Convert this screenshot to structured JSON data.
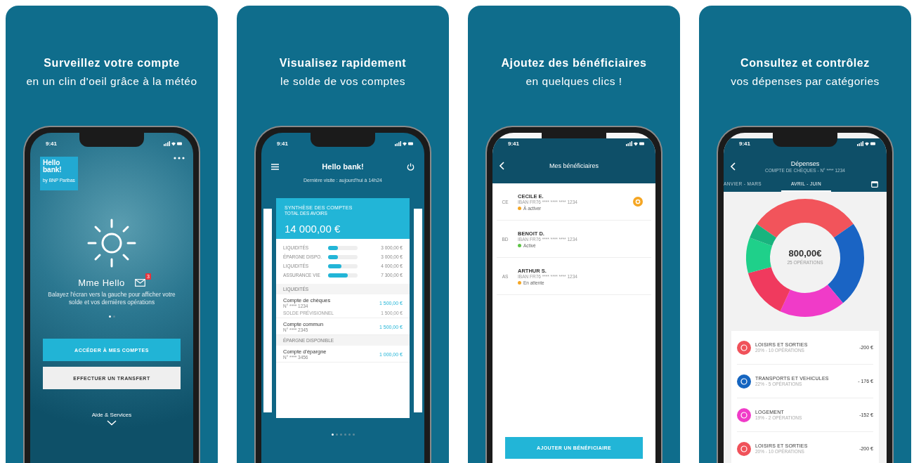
{
  "panels": [
    {
      "kind": "weather",
      "title": "Surveillez votre compte",
      "subtitle": "en un clin d'oeil grâce à la météo",
      "phone": {
        "time": "9:41",
        "logo": {
          "line_1": "Hello",
          "line_2": "bank!",
          "tagline": "by BNP Paribas"
        },
        "greeting": "Mme Hello",
        "message_badge": "3",
        "hint": "Balayez l'écran vers la gauche pour afficher votre solde et vos dernières opérations",
        "pages": [
          {
            "selected": true
          },
          {
            "selected": false
          }
        ],
        "buttons": [
          {
            "label": "ACCÉDER À MES COMPTES",
            "kind": "primary"
          },
          {
            "label": "EFFECTUER UN TRANSFERT",
            "kind": "secondary"
          }
        ],
        "help": "Aide & Services"
      }
    },
    {
      "kind": "accounts",
      "title": "Visualisez rapidement",
      "subtitle": "le solde de vos comptes",
      "phone": {
        "time": "9:41",
        "app_title": "Hello bank!",
        "last_visit": "Dernière visite : aujourd'hui à 14h24",
        "summary": {
          "title": "SYNTHÈSE DES COMPTES",
          "subtitle": "TOTAL DES AVOIRS",
          "total": "14 000,00 €",
          "bars": [
            {
              "label": "LIQUIDITÉS",
              "level": 0.33,
              "amount": "3 000,00 €"
            },
            {
              "label": "ÉPARGNE DISPO.",
              "level": 0.33,
              "amount": "3 000,00 €"
            },
            {
              "label": "LIQUIDITÉS",
              "level": 0.45,
              "amount": "4 000,00 €"
            },
            {
              "label": "ASSURANCE VIE",
              "level": 0.67,
              "amount": "7 300,00 €"
            }
          ]
        },
        "groups": [
          {
            "heading": "LIQUIDITÉS",
            "accounts": [
              {
                "name": "Compte de chèques",
                "number": "N° **** 1234",
                "balance": "1 500,00 €",
                "forecast_label": "SOLDE PRÉVISIONNEL",
                "forecast_amount": "1 500,00 €"
              },
              {
                "name": "Compte commun",
                "number": "N° **** 2345",
                "balance": "1 500,00 €"
              }
            ]
          },
          {
            "heading": "ÉPARGNE DISPONIBLE",
            "accounts": [
              {
                "name": "Compte d'épargne",
                "number": "N° **** 3456",
                "balance": "1 000,00 €"
              }
            ]
          }
        ],
        "pages": [
          {
            "selected": true
          },
          {
            "selected": false
          },
          {
            "selected": false
          },
          {
            "selected": false
          },
          {
            "selected": false
          },
          {
            "selected": false
          }
        ]
      }
    },
    {
      "kind": "beneficiaries",
      "title": "Ajoutez des bénéficiaires",
      "subtitle": "en quelques clics !",
      "phone": {
        "time": "9:41",
        "header": "Mes bénéficiaires",
        "beneficiaries": [
          {
            "initials": "CE",
            "name": "CECILE E.",
            "iban": "IBAN FR76 **** **** **** 1234",
            "status": "À activer",
            "color": "#f5a623",
            "pending_action": true
          },
          {
            "initials": "BD",
            "name": "BENOIT D.",
            "iban": "IBAN FR76 **** **** **** 1234",
            "status": "Activé",
            "color": "#5cc445",
            "pending_action": false
          },
          {
            "initials": "AS",
            "name": "ARTHUR S.",
            "iban": "IBAN FR76 **** **** **** 1234",
            "status": "En attente",
            "color": "#f5a623",
            "pending_action": false
          }
        ],
        "button": "AJOUTER UN BÉNÉFICIAIRE"
      }
    },
    {
      "kind": "expenses",
      "title": "Consultez et contrôlez",
      "subtitle": "vos dépenses par catégories",
      "phone": {
        "time": "9:41",
        "header": "Dépenses",
        "account": "COMPTE DE CHÈQUES - N° **** 1234",
        "periods": [
          {
            "label": "ANVIER - MARS",
            "selected": false
          },
          {
            "label": "AVRIL - JUIN",
            "selected": true
          }
        ],
        "total": "800,00€",
        "operations": "25 OPÉRATIONS",
        "categories": [
          {
            "name": "LOISIRS ET SORTIES",
            "detail": "20% - 10 OPÉRATIONS",
            "amount": "-200 €",
            "color": "#f0525a"
          },
          {
            "name": "TRANSPORTS ET VEHICULES",
            "detail": "22% - 5 OPÉRATIONS",
            "amount": "- 176 €",
            "color": "#1565c0"
          },
          {
            "name": "LOGEMENT",
            "detail": "19% - 2 OPÉRATIONS",
            "amount": "-152 €",
            "color": "#f03bc8"
          },
          {
            "name": "LOISIRS ET SORTIES",
            "detail": "20% - 10 OPÉRATIONS",
            "amount": "-200 €",
            "color": "#f0525a"
          }
        ]
      }
    }
  ]
}
